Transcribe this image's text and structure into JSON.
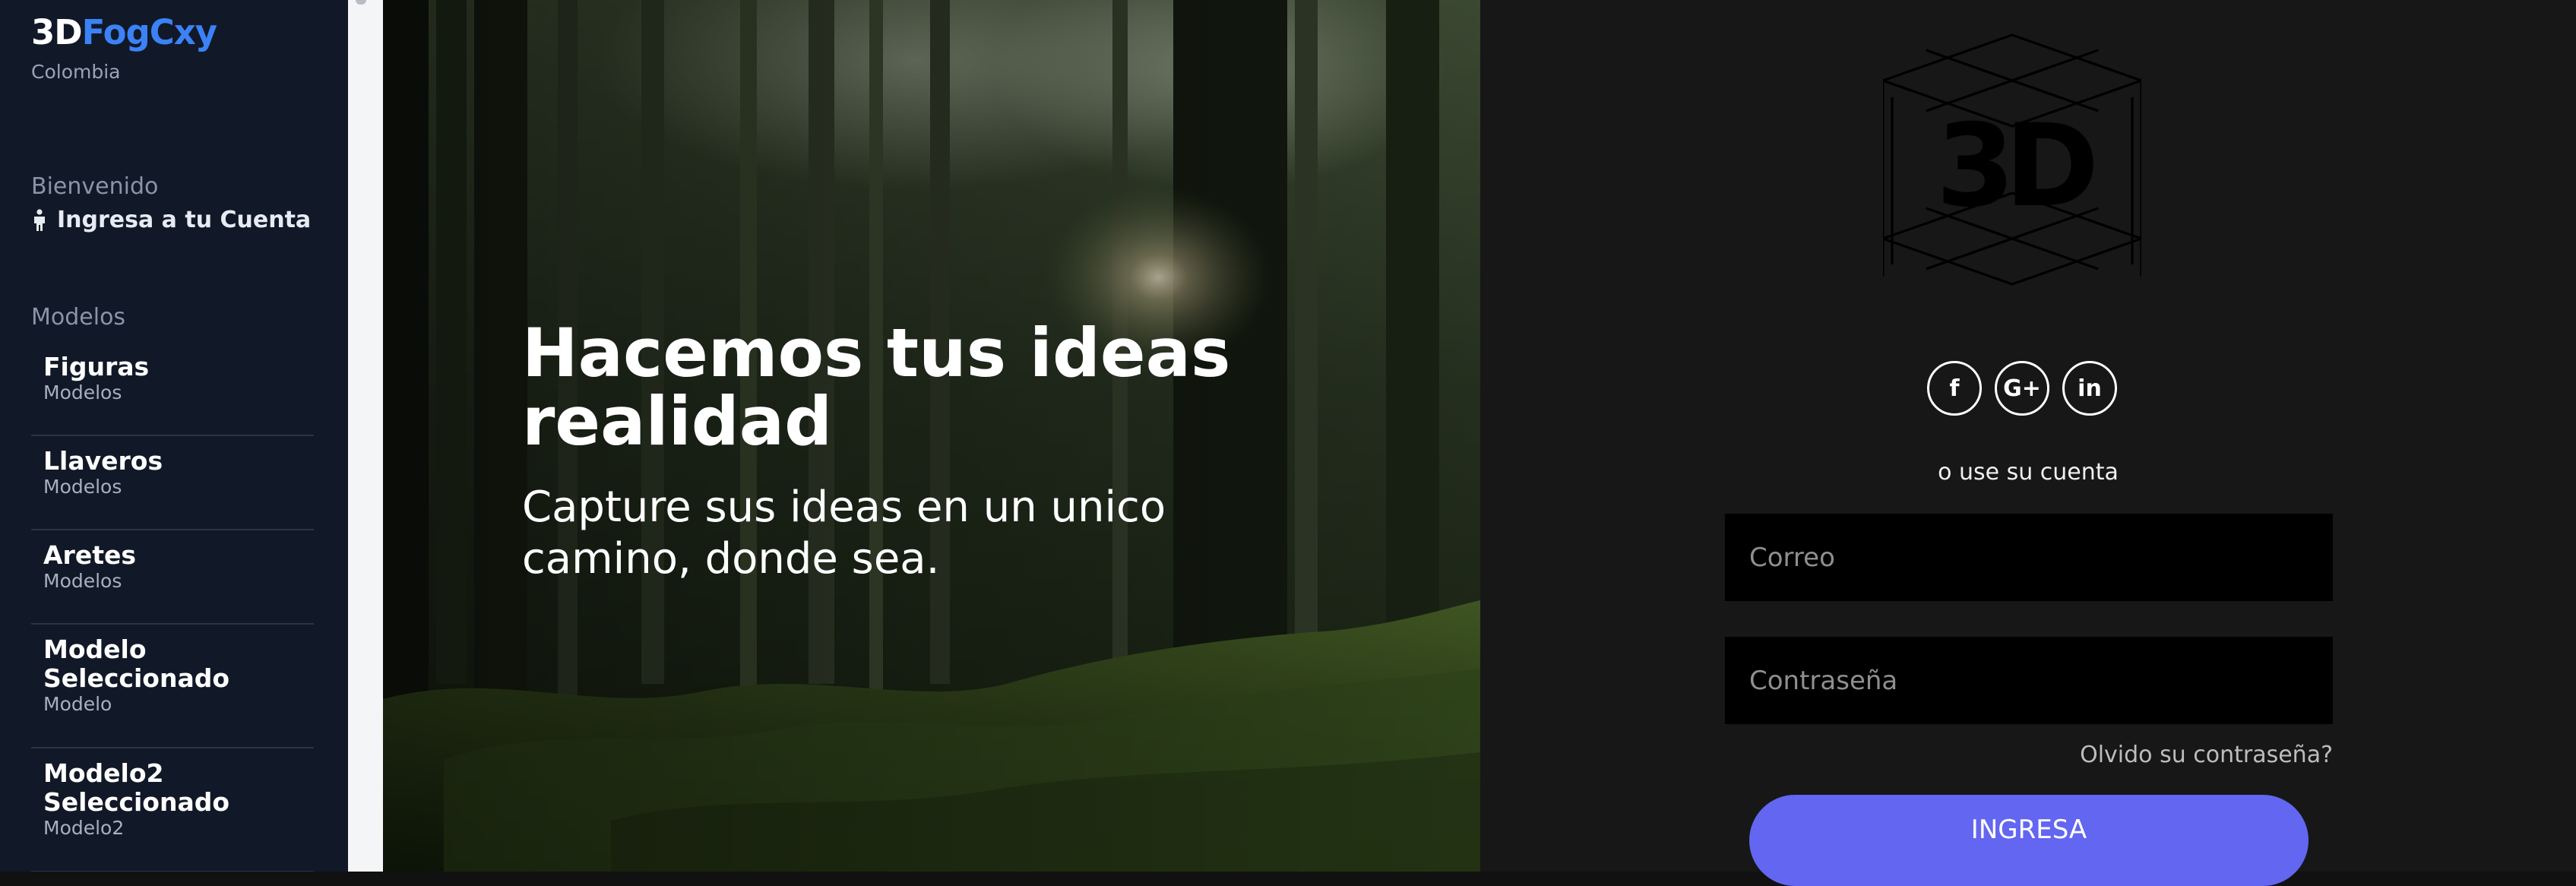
{
  "sidebar": {
    "brand_prefix": "3D",
    "brand_suffix": "FogCxy",
    "brand_sub": "Colombia",
    "welcome_label": "Bienvenido",
    "login_link": "Ingresa a tu Cuenta",
    "models_label": "Modelos",
    "models": [
      {
        "title": "Figuras",
        "subtitle": "Modelos"
      },
      {
        "title": "Llaveros",
        "subtitle": "Modelos"
      },
      {
        "title": "Aretes",
        "subtitle": "Modelos"
      },
      {
        "title": "Modelo Seleccionado",
        "subtitle": "Modelo"
      },
      {
        "title": "Modelo2 Seleccionado",
        "subtitle": "Modelo2"
      }
    ]
  },
  "hero": {
    "title": "Hacemos tus ideas realidad",
    "subtitle": "Capture sus ideas en un unico camino, donde sea."
  },
  "login": {
    "logo_text": "3D",
    "socials": [
      {
        "name": "facebook",
        "glyph": "f"
      },
      {
        "name": "google-plus",
        "glyph": "G+"
      },
      {
        "name": "linkedin",
        "glyph": "in"
      }
    ],
    "or_text": "o use su cuenta",
    "email_placeholder": "Correo",
    "password_placeholder": "Contraseña",
    "forgot": "Olvido su contraseña?",
    "submit": "INGRESA"
  },
  "colors": {
    "sidebar_bg": "#111827",
    "brand_accent": "#3b82f6",
    "panel_bg": "#171717",
    "input_bg": "#000000",
    "button": "#6366f1"
  }
}
